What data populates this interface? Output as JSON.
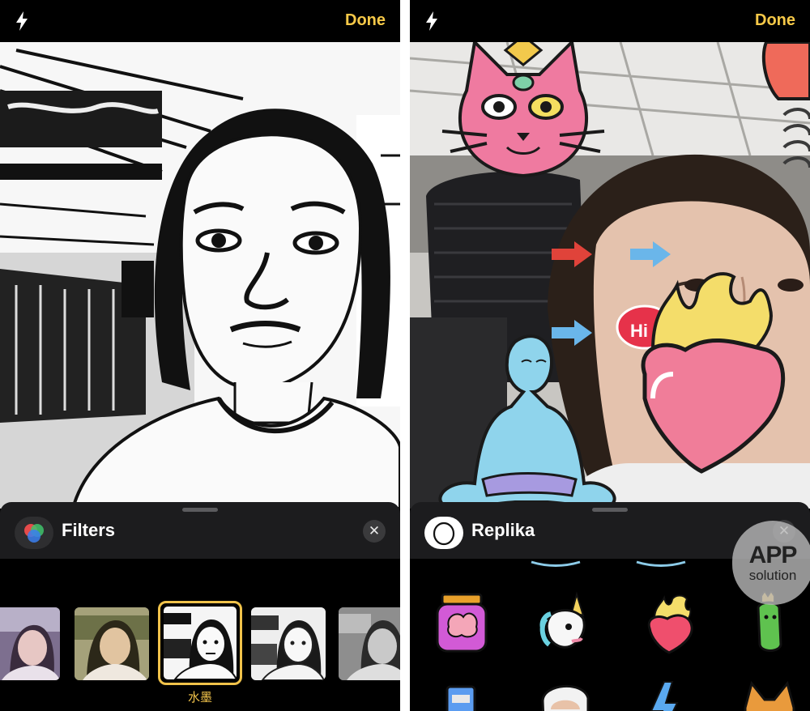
{
  "left_phone": {
    "done_label": "Done",
    "sheet": {
      "title": "Filters",
      "close_glyph": "✕",
      "selected_filter_label": "水墨"
    }
  },
  "right_phone": {
    "done_label": "Done",
    "viewport": {
      "bubble_text": "Hi"
    },
    "sheet": {
      "title": "Replika",
      "close_glyph": "✕"
    }
  },
  "watermark": {
    "line1": "APP",
    "line2": "solution"
  },
  "icons": {
    "flash": "flash-icon",
    "filters_app": "filters-icon",
    "replika_app": "replika-icon",
    "close": "close-icon"
  },
  "colors": {
    "accent_yellow": "#f0c24a",
    "done_yellow": "#f7c948",
    "sheet_bg": "#1c1c1e",
    "arrow_red": "#e0433a",
    "arrow_blue": "#6ab6ea"
  }
}
